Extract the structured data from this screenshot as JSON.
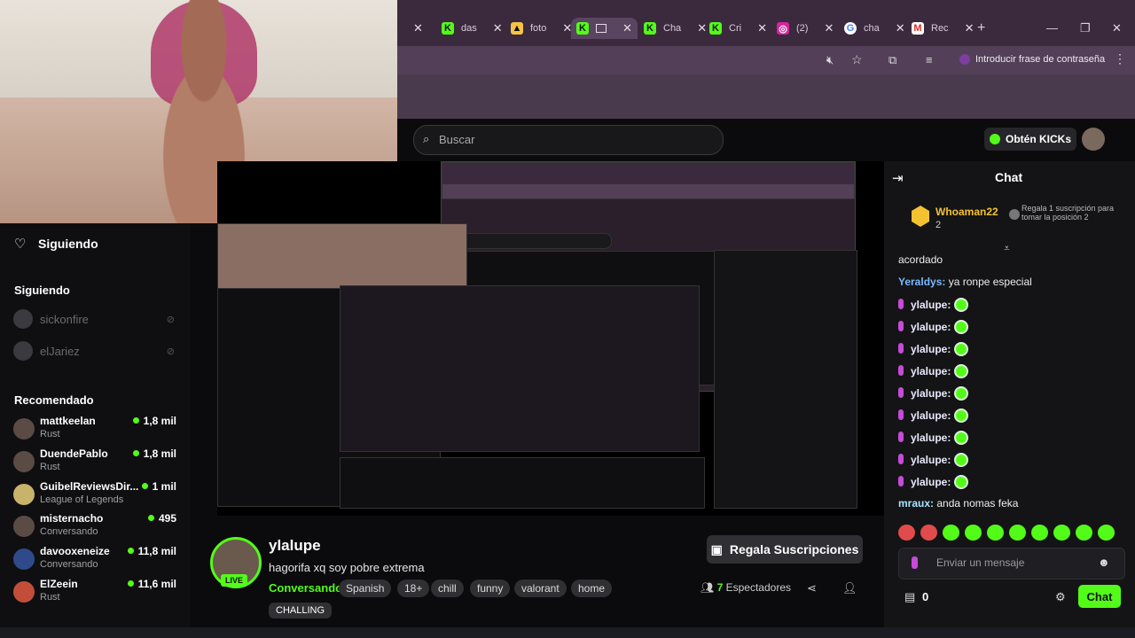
{
  "browser": {
    "tabs": [
      {
        "label": "das"
      },
      {
        "label": "foto"
      },
      {
        "label": ""
      },
      {
        "label": "Cha"
      },
      {
        "label": "Cri"
      },
      {
        "label": "(2)"
      },
      {
        "label": "cha"
      },
      {
        "label": "Rec"
      }
    ],
    "passphrase_label": "Introducir frase de contraseña"
  },
  "kick": {
    "search_placeholder": "Buscar",
    "get_kicks": "Obtén KICKs"
  },
  "sidebar": {
    "heading": "Siguiendo",
    "following_label": "Siguiendo",
    "following": [
      {
        "name": "sickonfire"
      },
      {
        "name": "elJariez"
      }
    ],
    "recommended_label": "Recomendado",
    "recommended": [
      {
        "name": "mattkeelan",
        "category": "Rust",
        "viewers": "1,8 mil"
      },
      {
        "name": "DuendePablo",
        "category": "Rust",
        "viewers": "1,8 mil"
      },
      {
        "name": "GuibelReviewsDir...",
        "category": "League of Legends",
        "viewers": "1 mil"
      },
      {
        "name": "misternacho",
        "category": "Conversando",
        "viewers": "495"
      },
      {
        "name": "davooxeneize",
        "category": "Conversando",
        "viewers": "11,8 mil"
      },
      {
        "name": "ElZeein",
        "category": "Rust",
        "viewers": "11,6 mil"
      }
    ]
  },
  "stream": {
    "streamer": "ylalupe",
    "live_label": "LIVE",
    "title": "hagorifa xq soy pobre extrema",
    "category": "Conversando",
    "tags": [
      "Spanish",
      "18+",
      "chill",
      "funny",
      "valorant",
      "home"
    ],
    "extra_tag": "CHALLING",
    "gift_subs": "Regala Suscripciones",
    "viewers_count": "7",
    "viewers_label": "Espectadores"
  },
  "chat": {
    "title": "Chat",
    "pinned": {
      "user": "Whoaman22",
      "count": "2",
      "text": "Regala 1 suscripción para tomar la posición 2"
    },
    "messages": [
      {
        "user": "",
        "text": "acordado"
      },
      {
        "user": "Yeraldys:",
        "text": "ya ronpe especial"
      },
      {
        "user": "ylalupe:",
        "text": ""
      },
      {
        "user": "ylalupe:",
        "text": ""
      },
      {
        "user": "ylalupe:",
        "text": ""
      },
      {
        "user": "ylalupe:",
        "text": ""
      },
      {
        "user": "ylalupe:",
        "text": ""
      },
      {
        "user": "ylalupe:",
        "text": ""
      },
      {
        "user": "ylalupe:",
        "text": ""
      },
      {
        "user": "ylalupe:",
        "text": ""
      },
      {
        "user": "ylalupe:",
        "text": ""
      },
      {
        "user": "mraux:",
        "text": "anda nomas feka"
      }
    ],
    "input_placeholder": "Enviar un mensaje",
    "points": "0",
    "send_label": "Chat"
  },
  "colors": {
    "accent": "#53fc18",
    "background": "#0b0b0d",
    "chrome": "#3b2a3d"
  }
}
